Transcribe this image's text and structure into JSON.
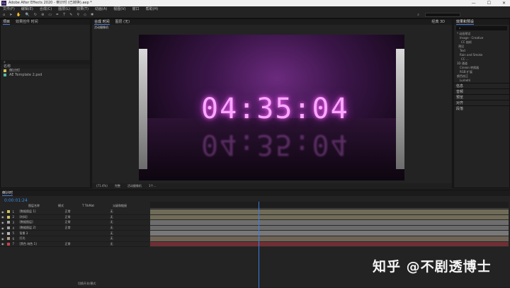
{
  "window": {
    "title": "Adobe After Effects 2020 - 倒计时 (已转换).aep *"
  },
  "menu": [
    "文件(F)",
    "编辑(E)",
    "合成(C)",
    "图层(L)",
    "效果(T)",
    "动画(A)",
    "视图(V)",
    "窗口",
    "帮助(H)"
  ],
  "project": {
    "tabs": [
      "项目",
      "效果控件 时间"
    ],
    "columns": [
      "名称"
    ],
    "items": [
      {
        "name": "倒计时",
        "color": "#d6c15a"
      },
      {
        "name": "AE Template 2.psd",
        "color": "#58b8a5"
      }
    ]
  },
  "composition": {
    "tabs": [
      "合成 时间",
      "图层 (无)"
    ],
    "viewer_label": "活动摄像机",
    "timecode_display": "04:35:04",
    "renderer": "经典 3D",
    "zoom": "(71.4%)",
    "quality": "完整",
    "camera": "活动摄像机",
    "views": "1个..."
  },
  "right_panel": {
    "title": "效果和预设",
    "items": [
      "* 动画预设",
      "Image - Creative",
      "CC 抽帧",
      "预设",
      "Text",
      "Rain and Smoke",
      "CC ...",
      "3D 通道",
      "Cineon 转换器",
      "RGB 扩展",
      "颜色校正",
      "Lumetri"
    ],
    "sections": [
      "信息",
      "音频",
      "预览",
      "对齐",
      "段落"
    ]
  },
  "timeline": {
    "tab": "倒计时",
    "current_time": "0:00:01:24",
    "columns": [
      "图层名称",
      "模式",
      "T TrkMat",
      "父级和链接"
    ],
    "layers": [
      {
        "num": "1",
        "name": "[数据图层 1]",
        "mode": "正常",
        "parent": "无",
        "color": "#cfc25e"
      },
      {
        "num": "2",
        "name": "[时间]",
        "mode": "正常",
        "parent": "无",
        "color": "#d0c061"
      },
      {
        "num": "3",
        "name": "[数据图层]",
        "mode": "正常",
        "parent": "无",
        "color": "#a3a3a3"
      },
      {
        "num": "4",
        "name": "[数据图层 2]",
        "mode": "正常",
        "parent": "无",
        "color": "#9e9e9e"
      },
      {
        "num": "5",
        "name": "背景 3",
        "mode": "",
        "parent": "无",
        "color": "#b7b7b7"
      },
      {
        "num": "6",
        "name": "灯光",
        "mode": "",
        "parent": "无",
        "color": "#b39c84"
      },
      {
        "num": "7",
        "name": "[黑色 纯色 1]",
        "mode": "正常",
        "parent": "无",
        "color": "#c8444b"
      }
    ],
    "bottom_label": "切换开关/模式"
  },
  "watermark": "知乎 @不剧透博士"
}
